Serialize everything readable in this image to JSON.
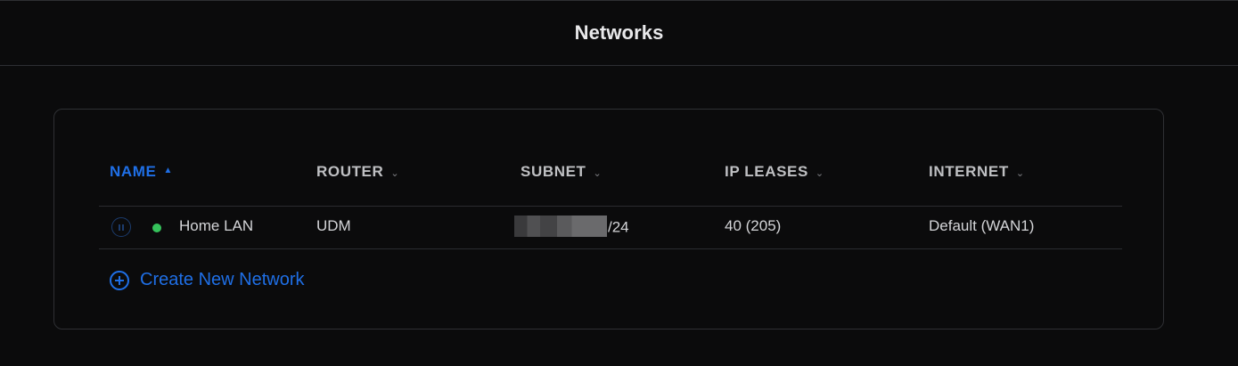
{
  "page": {
    "title": "Networks"
  },
  "table": {
    "columns": [
      {
        "label": "NAME",
        "sort": "chevron-up-icon",
        "active": true
      },
      {
        "label": "ROUTER",
        "sort": "chevron-down-icon",
        "active": false
      },
      {
        "label": "SUBNET",
        "sort": "chevron-down-icon",
        "active": false
      },
      {
        "label": "IP LEASES",
        "sort": "chevron-down-icon",
        "active": false
      },
      {
        "label": "INTERNET",
        "sort": "chevron-down-icon",
        "active": false
      }
    ],
    "rows": [
      {
        "name": "Home LAN",
        "status": "online",
        "router": "UDM",
        "subnet_suffix": "/24",
        "ip_leases": "40 (205)",
        "internet": "Default (WAN1)"
      }
    ]
  },
  "actions": {
    "create_label": "Create New Network"
  },
  "colors": {
    "accent": "#1f6fe6",
    "status_online": "#35c25b",
    "background": "#0b0b0c"
  }
}
